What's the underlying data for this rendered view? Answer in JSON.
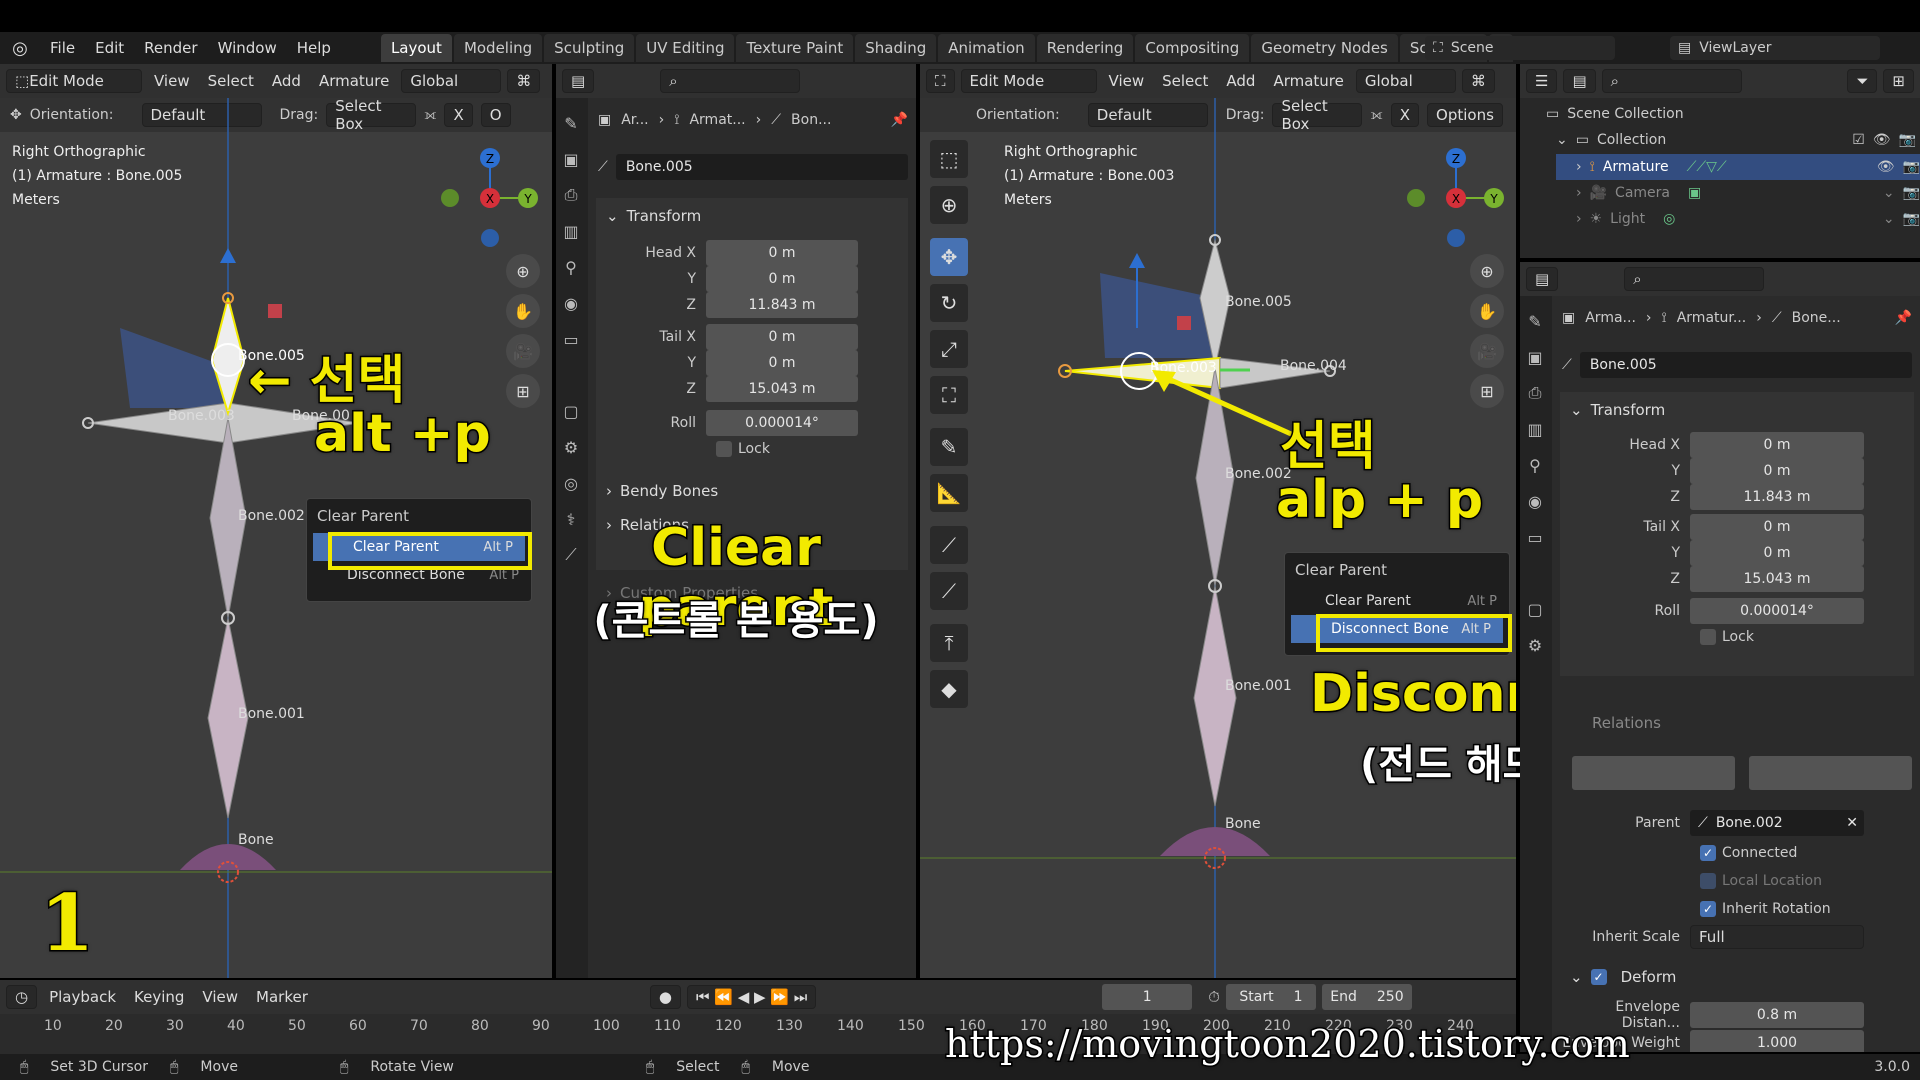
{
  "menu": {
    "items": [
      "File",
      "Edit",
      "Render",
      "Window",
      "Help"
    ]
  },
  "workspaces": [
    "Layout",
    "Modeling",
    "Sculpting",
    "UV Editing",
    "Texture Paint",
    "Shading",
    "Animation",
    "Rendering",
    "Compositing",
    "Geometry Nodes",
    "Scripting"
  ],
  "workspace_add": "+",
  "scene": {
    "name": "Scene",
    "viewlayer": "ViewLayer"
  },
  "left_viewport": {
    "mode": "Edit Mode",
    "menus": [
      "View",
      "Select",
      "Add",
      "Armature"
    ],
    "transform": "Global",
    "orientation_label": "Orientation:",
    "orientation": "Default",
    "drag_label": "Drag:",
    "drag": "Select Box",
    "x_btn": "X",
    "options": "O",
    "view_name": "Right Orthographic",
    "object_info": "(1) Armature : Bone.005",
    "units": "Meters",
    "bones": [
      "Bone.005",
      "Bone.003",
      "Bone.00",
      "Bone.002",
      "Bone.001",
      "Bone"
    ],
    "axis": {
      "z": "Z",
      "x": "X",
      "y": "Y"
    }
  },
  "left_menu": {
    "title": "Clear Parent",
    "items": [
      {
        "label": "Clear Parent",
        "shortcut": "Alt P"
      },
      {
        "label": "Disconnect Bone",
        "shortcut": "Alt P"
      }
    ]
  },
  "left_captions": {
    "select": "← 선택",
    "shortcut": "alt +p",
    "clear": "Cliear parent",
    "clear_sub": "(콘트롤 본 용도)",
    "step": "1"
  },
  "mid_props": {
    "breadcrumb": [
      "Ar...",
      "Armat...",
      "Bon..."
    ],
    "bone_name": "Bone.005",
    "transform": "Transform",
    "head": {
      "label": "Head X",
      "x": "0 m",
      "y": "0 m",
      "z": "11.843 m"
    },
    "tail": {
      "label": "Tail X",
      "x": "0 m",
      "y": "0 m",
      "z": "15.043 m"
    },
    "y_label": "Y",
    "z_label": "Z",
    "roll_label": "Roll",
    "roll": "0.000014°",
    "lock": "Lock",
    "bendy": "Bendy Bones",
    "relations": "Relations",
    "custom": "Custom Properties"
  },
  "right_viewport": {
    "mode": "Edit Mode",
    "menus": [
      "View",
      "Select",
      "Add",
      "Armature"
    ],
    "transform": "Global",
    "orientation_label": "Orientation:",
    "orientation": "Default",
    "drag_label": "Drag:",
    "drag": "Select Box",
    "x_btn": "X",
    "options": "Options",
    "view_name": "Right Orthographic",
    "object_info": "(1) Armature : Bone.003",
    "units": "Meters",
    "bones": [
      "Bone.005",
      "Bone.003",
      "Bone.004",
      "Bone.002",
      "Bone.001",
      "Bone"
    ],
    "axis": {
      "z": "Z",
      "x": "X",
      "y": "Y"
    }
  },
  "right_menu": {
    "title": "Clear Parent",
    "items": [
      {
        "label": "Clear Parent",
        "shortcut": "Alt P"
      },
      {
        "label": "Disconnect Bone",
        "shortcut": "Alt P"
      }
    ]
  },
  "right_captions": {
    "select": "선택",
    "shortcut": "alp + p",
    "disconnect": "Disconnect bone",
    "disconnect_sub": "(전드 해드 부분)"
  },
  "outliner": {
    "scene_collection": "Scene Collection",
    "collection": "Collection",
    "items": [
      {
        "name": "Armature",
        "active": true
      },
      {
        "name": "Camera",
        "active": false
      },
      {
        "name": "Light",
        "active": false
      }
    ]
  },
  "right_props": {
    "breadcrumb": [
      "Arma...",
      "Armatur...",
      "Bone..."
    ],
    "bone_name": "Bone.005",
    "transform": "Transform",
    "head": {
      "label": "Head X",
      "x": "0 m",
      "y": "0 m",
      "z": "11.843 m"
    },
    "tail": {
      "label": "Tail X",
      "x": "0 m",
      "y": "0 m",
      "z": "15.043 m"
    },
    "y_label": "Y",
    "z_label": "Z",
    "roll_label": "Roll",
    "roll": "0.000014°",
    "lock": "Lock",
    "relations": "Relations",
    "parent_label": "Parent",
    "parent": "Bone.002",
    "connected": "Connected",
    "local_location": "Local Location",
    "inherit_rotation": "Inherit Rotation",
    "inherit_scale_label": "Inherit Scale",
    "inherit_scale": "Full",
    "deform": "Deform",
    "envelope_dist_label": "Envelope Distan...",
    "envelope_dist": "0.8 m",
    "envelope_weight_label": "Envelope Weight",
    "envelope_weight": "1.000"
  },
  "timeline": {
    "menus": [
      "Playback",
      "Keying",
      "View",
      "Marker"
    ],
    "frame": "1",
    "start_label": "Start",
    "start": "1",
    "end_label": "End",
    "end": "250",
    "ticks": [
      "10",
      "20",
      "30",
      "40",
      "50",
      "60",
      "70",
      "80",
      "90",
      "100",
      "110",
      "120",
      "130",
      "140",
      "150",
      "160",
      "170",
      "180",
      "190",
      "200",
      "210",
      "220",
      "230",
      "240"
    ]
  },
  "statusbar": {
    "items": [
      "Set 3D Cursor",
      "Move",
      "Rotate View",
      "Select",
      "Move"
    ],
    "version": "3.0.0"
  },
  "watermark": "https://movingtoon2020.tistory.com",
  "colors": {
    "accent": "#4772b3",
    "caption_yellow": "#f2ea00",
    "bone_selected": "#f2ea00"
  }
}
